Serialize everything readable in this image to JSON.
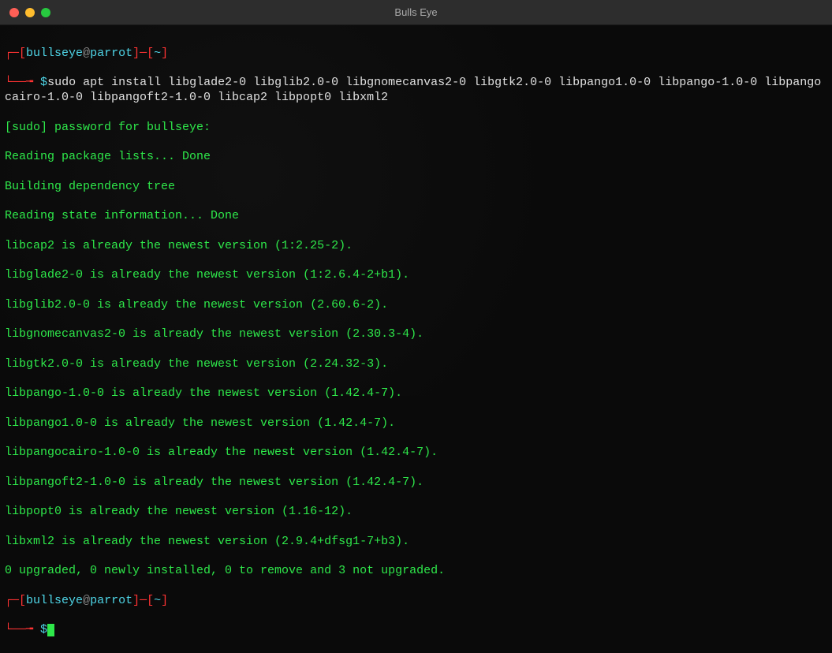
{
  "window": {
    "title": "Bulls Eye"
  },
  "prompt": {
    "bracket_open": "[",
    "bracket_close": "]",
    "user": "bullseye",
    "at": "@",
    "host": "parrot",
    "sep": "]─[",
    "path": "~",
    "dollar": "$",
    "corner_top": "┌─",
    "corner_bottom": "└──╼ "
  },
  "command": "sudo apt install libglade2-0 libglib2.0-0 libgnomecanvas2-0 libgtk2.0-0 libpango1.0-0 libpango-1.0-0 libpangocairo-1.0-0 libpangoft2-1.0-0 libcap2 libpopt0 libxml2",
  "output": {
    "l1": "[sudo] password for bullseye:",
    "l2": "Reading package lists... Done",
    "l3": "Building dependency tree",
    "l4": "Reading state information... Done",
    "l5": "libcap2 is already the newest version (1:2.25-2).",
    "l6": "libglade2-0 is already the newest version (1:2.6.4-2+b1).",
    "l7": "libglib2.0-0 is already the newest version (2.60.6-2).",
    "l8": "libgnomecanvas2-0 is already the newest version (2.30.3-4).",
    "l9": "libgtk2.0-0 is already the newest version (2.24.32-3).",
    "l10": "libpango-1.0-0 is already the newest version (1.42.4-7).",
    "l11": "libpango1.0-0 is already the newest version (1.42.4-7).",
    "l12": "libpangocairo-1.0-0 is already the newest version (1.42.4-7).",
    "l13": "libpangoft2-1.0-0 is already the newest version (1.42.4-7).",
    "l14": "libpopt0 is already the newest version (1.16-12).",
    "l15": "libxml2 is already the newest version (2.9.4+dfsg1-7+b3).",
    "l16": "0 upgraded, 0 newly installed, 0 to remove and 3 not upgraded."
  }
}
